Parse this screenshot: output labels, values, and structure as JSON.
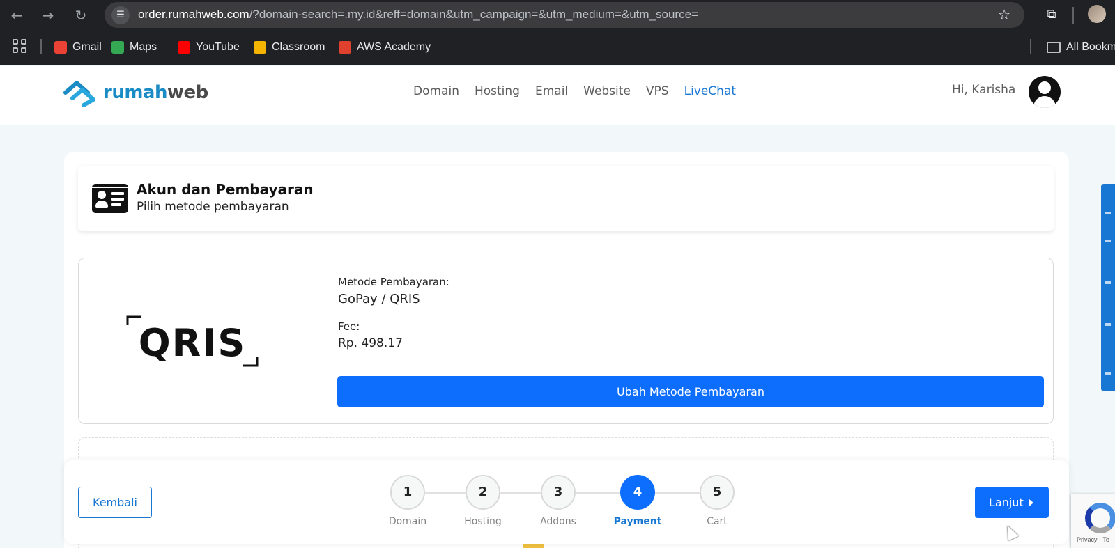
{
  "browser": {
    "url_host": "order.rumahweb.com",
    "url_path": "/?domain-search=.my.id&reff=domain&utm_campaign=&utm_medium=&utm_source=",
    "bookmarks": [
      {
        "label": "Gmail",
        "icon": "gmail-icon",
        "color": "#ea4335"
      },
      {
        "label": "Maps",
        "icon": "maps-icon",
        "color": "#34a853"
      },
      {
        "label": "YouTube",
        "icon": "youtube-icon",
        "color": "#ff0000"
      },
      {
        "label": "Classroom",
        "icon": "classroom-icon",
        "color": "#f4b400"
      },
      {
        "label": "AWS Academy",
        "icon": "aws-academy-icon",
        "color": "#e0412f"
      }
    ],
    "all_bookmarks_label": "All Bookm"
  },
  "site": {
    "logo_part1": "rumah",
    "logo_part2": "web",
    "nav": [
      {
        "label": "Domain",
        "active": false
      },
      {
        "label": "Hosting",
        "active": false
      },
      {
        "label": "Email",
        "active": false
      },
      {
        "label": "Website",
        "active": false
      },
      {
        "label": "VPS",
        "active": false
      },
      {
        "label": "LiveChat",
        "active": true
      }
    ],
    "greeting": "Hi, Karisha"
  },
  "section": {
    "title": "Akun dan Pembayaran",
    "subtitle": "Pilih metode pembayaran"
  },
  "payment": {
    "logo_text": "QRIS",
    "method_label": "Metode Pembayaran:",
    "method_value": "GoPay / QRIS",
    "fee_label": "Fee:",
    "fee_value": "Rp. 498.17",
    "change_button": "Ubah Metode Pembayaran"
  },
  "stepper": {
    "back_button": "Kembali",
    "next_button": "Lanjut",
    "steps": [
      {
        "number": "1",
        "label": "Domain",
        "active": false
      },
      {
        "number": "2",
        "label": "Hosting",
        "active": false
      },
      {
        "number": "3",
        "label": "Addons",
        "active": false
      },
      {
        "number": "4",
        "label": "Payment",
        "active": true
      },
      {
        "number": "5",
        "label": "Cart",
        "active": false
      }
    ]
  },
  "recaptcha": {
    "text": "Privacy - Te"
  },
  "colors": {
    "accent": "#0d6efd",
    "brand": "#1a8bc5",
    "link": "#1877d2"
  }
}
